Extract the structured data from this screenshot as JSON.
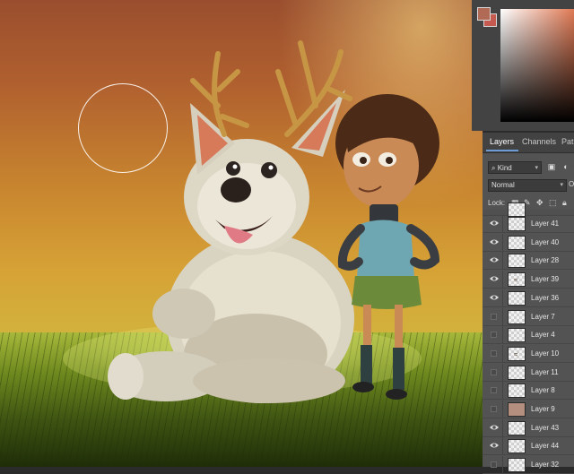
{
  "panels": {
    "tabs": [
      {
        "label": "Layers",
        "active": true
      },
      {
        "label": "Channels",
        "active": false
      },
      {
        "label": "Pat",
        "active": false
      }
    ],
    "filter_kind": "Kind",
    "blend_mode": "Normal",
    "opacity_label": "O",
    "lock_label": "Lock:"
  },
  "colors": {
    "foreground": "#b06a55",
    "background": "#c55a50"
  },
  "layers": [
    {
      "name": "Layer 41",
      "visible": true,
      "thumb": "transparent"
    },
    {
      "name": "Layer 40",
      "visible": true,
      "thumb": "transparent"
    },
    {
      "name": "Layer 28",
      "visible": true,
      "thumb": "transparent"
    },
    {
      "name": "Layer 39",
      "visible": true,
      "thumb": "sketch"
    },
    {
      "name": "Layer 36",
      "visible": true,
      "thumb": "transparent"
    },
    {
      "name": "Layer 7",
      "visible": false,
      "thumb": "transparent"
    },
    {
      "name": "Layer 4",
      "visible": false,
      "thumb": "transparent"
    },
    {
      "name": "Layer 10",
      "visible": false,
      "thumb": "sketch"
    },
    {
      "name": "Layer 11",
      "visible": false,
      "thumb": "transparent"
    },
    {
      "name": "Layer 8",
      "visible": false,
      "thumb": "transparent"
    },
    {
      "name": "Layer 9",
      "visible": false,
      "thumb": "solid"
    },
    {
      "name": "Layer 43",
      "visible": true,
      "thumb": "transparent"
    },
    {
      "name": "Layer 44",
      "visible": true,
      "thumb": "transparent"
    },
    {
      "name": "Layer 32",
      "visible": false,
      "thumb": "transparent"
    }
  ],
  "icons": {
    "eye": "eye-icon",
    "search": "search-icon",
    "lock": "lock-icon",
    "brush": "brush-icon",
    "move": "move-icon",
    "artboard": "artboard-icon"
  }
}
